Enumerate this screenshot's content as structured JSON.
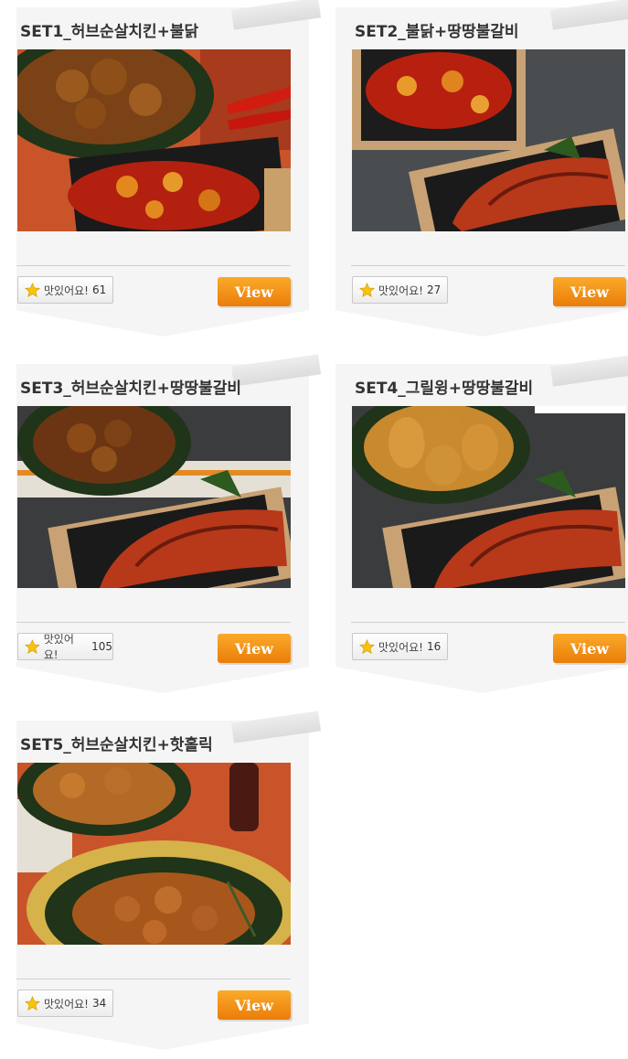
{
  "cards": [
    {
      "title": "SET1_허브순살치킨+불닭",
      "like_label": "맛있어요!",
      "like_count": "61",
      "view_label": "View",
      "photo_icon": "chicken-set-photo"
    },
    {
      "title": "SET2_불닭+땅땅불갈비",
      "like_label": "맛있어요!",
      "like_count": "27",
      "view_label": "View",
      "photo_icon": "chicken-set-photo"
    },
    {
      "title": "SET3_허브순살치킨+땅땅불갈비",
      "like_label": "맛있어요!",
      "like_count": "105",
      "view_label": "View",
      "photo_icon": "chicken-set-photo"
    },
    {
      "title": "SET4_그릴윙+땅땅불갈비",
      "like_label": "맛있어요!",
      "like_count": "16",
      "view_label": "View",
      "photo_icon": "chicken-set-photo"
    },
    {
      "title": "SET5_허브순살치킨+핫홀릭",
      "like_label": "맛있어요!",
      "like_count": "34",
      "view_label": "View",
      "photo_icon": "chicken-set-photo"
    }
  ],
  "colors": {
    "accent": "#f08a12",
    "card_bg": "#f5f5f5",
    "star": "#f6c40b"
  }
}
